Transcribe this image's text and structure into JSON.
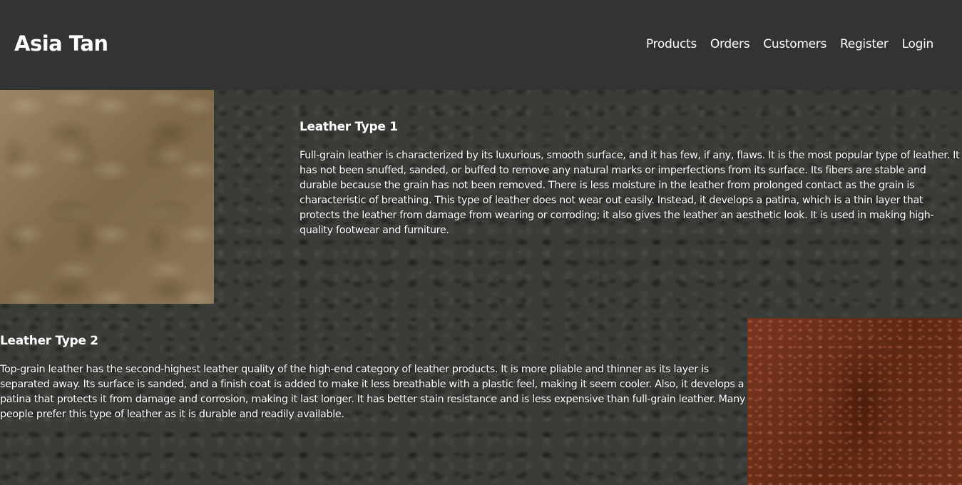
{
  "navbar": {
    "brand": "Asia Tan",
    "links": [
      "Products",
      "Orders",
      "Customers",
      "Register",
      "Login"
    ]
  },
  "sections": [
    {
      "title": "Leather Type 1",
      "body": "Full-grain leather is characterized by its luxurious, smooth surface, and it has few, if any, flaws. It is the most popular type of leather. It has not been snuffed, sanded, or buffed to remove any natural marks or imperfections from its surface. Its fibers are stable and durable because the grain has not been removed. There is less moisture in the leather from prolonged contact as the grain is characteristic of breathing. This type of leather does not wear out easily. Instead, it develops a patina, which is a thin layer that protects the leather from damage from wearing or corroding; it also gives the leather an aesthetic look. It is used in making high-quality footwear and furniture."
    },
    {
      "title": "Leather Type 2",
      "body": "Top-grain leather has the second-highest leather quality of the high-end category of leather products. It is more pliable and thinner as its layer is separated away. Its surface is sanded, and a finish coat is added to make it less breathable with a plastic feel, making it seem cooler. Also, it develops a patina that protects it from damage and corrosion, making it last longer. It has better stain resistance and is less expensive than full-grain leather. Many people prefer this type of leather as it is durable and readily available."
    }
  ],
  "colors": {
    "navbar_bg": "#333333",
    "text": "#ffffff",
    "leather_1": "#8a7455",
    "leather_2": "#6a2e18",
    "page_bg": "#3a3c38"
  }
}
